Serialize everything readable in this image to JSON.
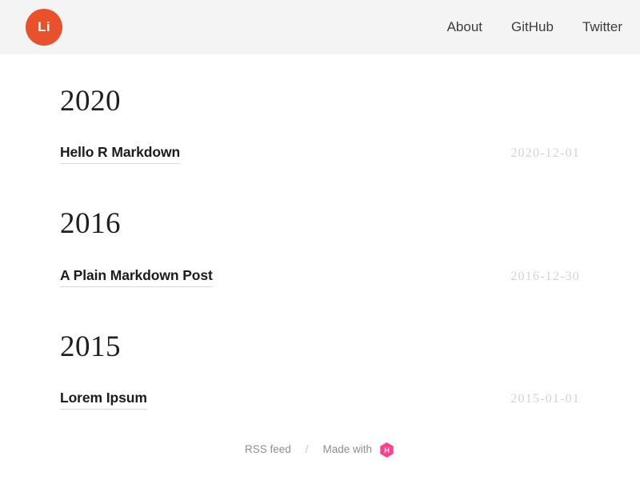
{
  "header": {
    "logo": {
      "text": "Li",
      "color": "#e8512b",
      "icon": "circle-avatar"
    },
    "nav": [
      {
        "label": "About"
      },
      {
        "label": "GitHub"
      },
      {
        "label": "Twitter"
      }
    ]
  },
  "main": {
    "year_groups": [
      {
        "year": "2020",
        "posts": [
          {
            "title": "Hello R Markdown",
            "date": "2020-12-01"
          }
        ]
      },
      {
        "year": "2016",
        "posts": [
          {
            "title": "A Plain Markdown Post",
            "date": "2016-12-30"
          }
        ]
      },
      {
        "year": "2015",
        "posts": [
          {
            "title": "Lorem Ipsum",
            "date": "2015-01-01"
          }
        ]
      }
    ]
  },
  "footer": {
    "rss_label": "RSS feed",
    "separator": "/",
    "made_with_label": "Made with",
    "generator_icon": "hugo-hexagon-icon",
    "generator_letter": "H",
    "generator_color": "#ff4088"
  }
}
